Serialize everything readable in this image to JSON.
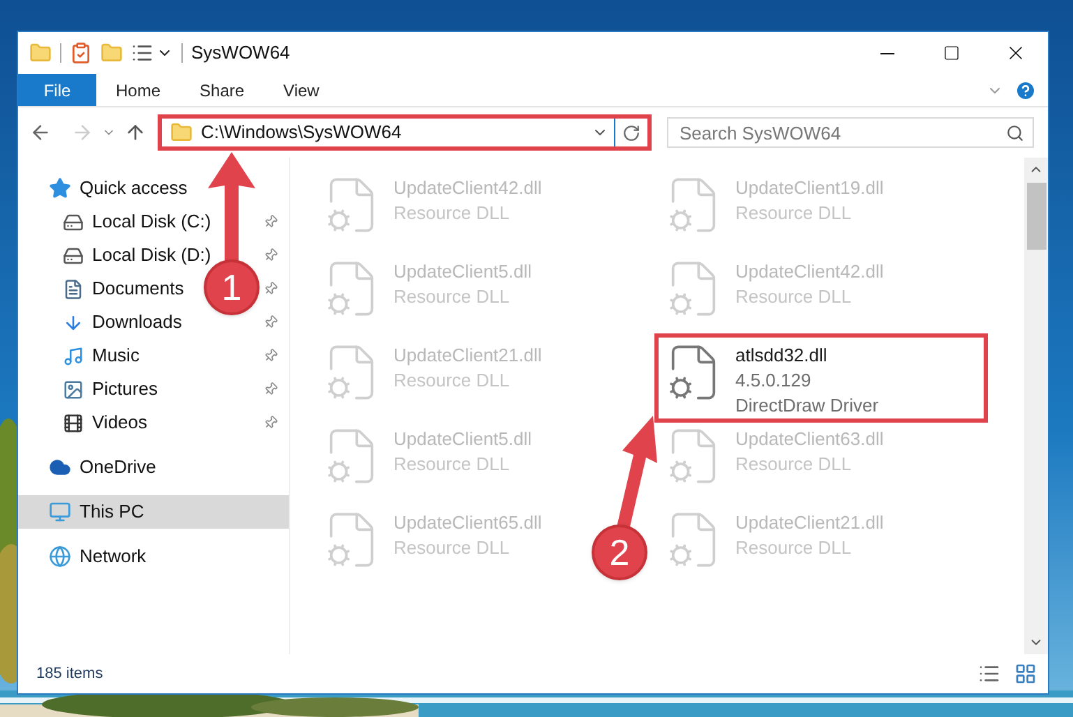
{
  "window": {
    "title": "SysWOW64"
  },
  "ribbon_tabs": [
    {
      "label": "File",
      "kind": "menu"
    },
    {
      "label": "Home",
      "kind": "tab"
    },
    {
      "label": "Share",
      "kind": "tab"
    },
    {
      "label": "View",
      "kind": "tab"
    }
  ],
  "address": {
    "path": "C:\\Windows\\SysWOW64",
    "highlighted": true
  },
  "search": {
    "placeholder": "Search SysWOW64"
  },
  "sidebar": {
    "items": [
      {
        "label": "Quick access",
        "selected": false,
        "children": [
          {
            "label": "Local Disk (C:)",
            "pinned": true,
            "selected": false
          },
          {
            "label": "Local Disk (D:)",
            "pinned": true,
            "selected": false
          },
          {
            "label": "Documents",
            "pinned": true,
            "selected": false
          },
          {
            "label": "Downloads",
            "pinned": true,
            "selected": false
          },
          {
            "label": "Music",
            "pinned": true,
            "selected": false
          },
          {
            "label": "Pictures",
            "pinned": true,
            "selected": false
          },
          {
            "label": "Videos",
            "pinned": true,
            "selected": false
          }
        ]
      },
      {
        "label": "OneDrive",
        "selected": false
      },
      {
        "label": "This PC",
        "selected": true
      },
      {
        "label": "Network",
        "selected": false
      }
    ]
  },
  "files": [
    {
      "name": "UpdateClient42.dll",
      "details": [
        "Resource DLL"
      ],
      "blurred": true,
      "highlighted": false
    },
    {
      "name": "UpdateClient19.dll",
      "details": [
        "Resource DLL"
      ],
      "blurred": true,
      "highlighted": false
    },
    {
      "name": "UpdateClient5.dll",
      "details": [
        "Resource DLL"
      ],
      "blurred": true,
      "highlighted": false
    },
    {
      "name": "UpdateClient42.dll",
      "details": [
        "Resource DLL"
      ],
      "blurred": true,
      "highlighted": false
    },
    {
      "name": "UpdateClient21.dll",
      "details": [
        "Resource DLL"
      ],
      "blurred": true,
      "highlighted": false
    },
    {
      "name": "atlsdd32.dll",
      "details": [
        "4.5.0.129",
        "DirectDraw Driver"
      ],
      "blurred": false,
      "highlighted": true
    },
    {
      "name": "UpdateClient5.dll",
      "details": [
        "Resource DLL"
      ],
      "blurred": true,
      "highlighted": false
    },
    {
      "name": "UpdateClient63.dll",
      "details": [
        "Resource DLL"
      ],
      "blurred": true,
      "highlighted": false
    },
    {
      "name": "UpdateClient65.dll",
      "details": [
        "Resource DLL"
      ],
      "blurred": true,
      "highlighted": false
    },
    {
      "name": "UpdateClient21.dll",
      "details": [
        "Resource DLL"
      ],
      "blurred": true,
      "highlighted": false
    }
  ],
  "annotations": [
    {
      "label": "1"
    },
    {
      "label": "2"
    }
  ],
  "status_bar": {
    "count": "185 items"
  }
}
